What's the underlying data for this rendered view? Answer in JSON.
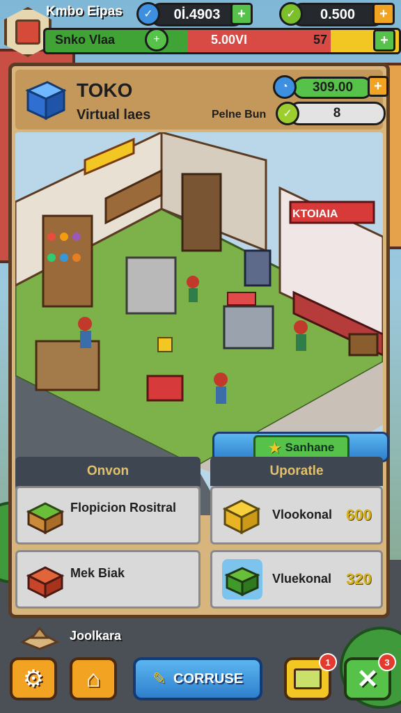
{
  "hud": {
    "player_name": "Kmbo Eipas",
    "coins": "0İ.4903",
    "gems": "0.500",
    "level_label": "Snko Vlaa",
    "level_progress_value": "5.00VI",
    "level_number": "57"
  },
  "shop": {
    "title": "TOKO",
    "subtitle": "Virtual laes",
    "balance": "309.00",
    "price_label": "Pelne Bun",
    "price_value": "8"
  },
  "scene": {
    "store_sign": "KTOIAIA",
    "confirm_button": "Sanhane"
  },
  "columns": {
    "left_header": "Onvon",
    "right_header": "Uporatle"
  },
  "items": [
    {
      "name": "Flopicion Rositral",
      "icon": "produce-crate-icon"
    },
    {
      "name": "Mek Biak",
      "icon": "red-crate-icon"
    }
  ],
  "upgrades": [
    {
      "name": "Vlookonal",
      "price": "600",
      "icon": "yellow-box-icon"
    },
    {
      "name": "Vluekonal",
      "price": "320",
      "icon": "green-cart-icon"
    }
  ],
  "footer": {
    "label": "Joolkara",
    "main_button": "CORRUSE",
    "badge1": "1",
    "badge2": "3"
  },
  "colors": {
    "panel": "#d8b57d",
    "frame": "#5b3b22",
    "green": "#40a336",
    "blue": "#2f7fcc",
    "gold": "#d6b21c"
  }
}
